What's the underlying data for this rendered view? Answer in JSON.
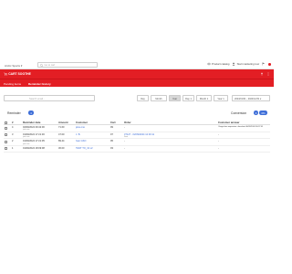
{
  "topbar": {
    "store_select": "Arctic Sports ▾",
    "search_placeholder": "Go to cart",
    "tools": [
      {
        "icon": "eye-icon",
        "label": "Product catalog"
      },
      {
        "icon": "user-icon",
        "label": "Start marketing tour"
      }
    ]
  },
  "app": {
    "logo": "CART SOOTHE",
    "tabs": [
      "Pending items",
      "Reminder history"
    ]
  },
  "filters": {
    "search_placeholder": "Search email...",
    "periods": [
      "Day",
      "Month",
      "Year",
      "Day 1",
      "Month 1",
      "Year 1"
    ],
    "selected_period": "Year",
    "date_range": "2024/01/01 - 2024/12/31 ▾"
  },
  "reminders": {
    "title": "Reminder",
    "count": "4",
    "conversion_title": "Conversion",
    "conversion_count": "0",
    "conversion_pct": "0%"
  },
  "table": {
    "headers": [
      "#",
      "Reminder date",
      "Amount",
      "Customer",
      "Cart",
      "Order",
      "Customer answer"
    ],
    "rows": [
      {
        "id": "4",
        "date": "02/09/2024 09:42:00",
        "sub": "just now",
        "amount": "71.60",
        "customer": "jane.one",
        "cart": "99",
        "order": "-",
        "answer": "I forgot two expensive chocolate 06/09/2024 09:27:01"
      },
      {
        "id": "3",
        "date": "01/09/2024 17:21:30",
        "sub": "just now",
        "amount": "47.00",
        "customer": "J. B.",
        "cart": "97",
        "order": "37127 - 02/09/2024 12:30:11",
        "order_sub": "Sent",
        "answer": "-"
      },
      {
        "id": "2",
        "date": "01/09/2024 17:21:05",
        "sub": "just now",
        "amount": "89.44",
        "customer": "Ivan GSO",
        "cart": "95",
        "order": "-",
        "answer": "-"
      },
      {
        "id": "1",
        "date": "01/09/2024 18:09:08",
        "sub": "",
        "amount": "30.00",
        "customer": "TEST TO_31 v2",
        "cart": "93",
        "order": "-",
        "answer": "-"
      }
    ]
  }
}
